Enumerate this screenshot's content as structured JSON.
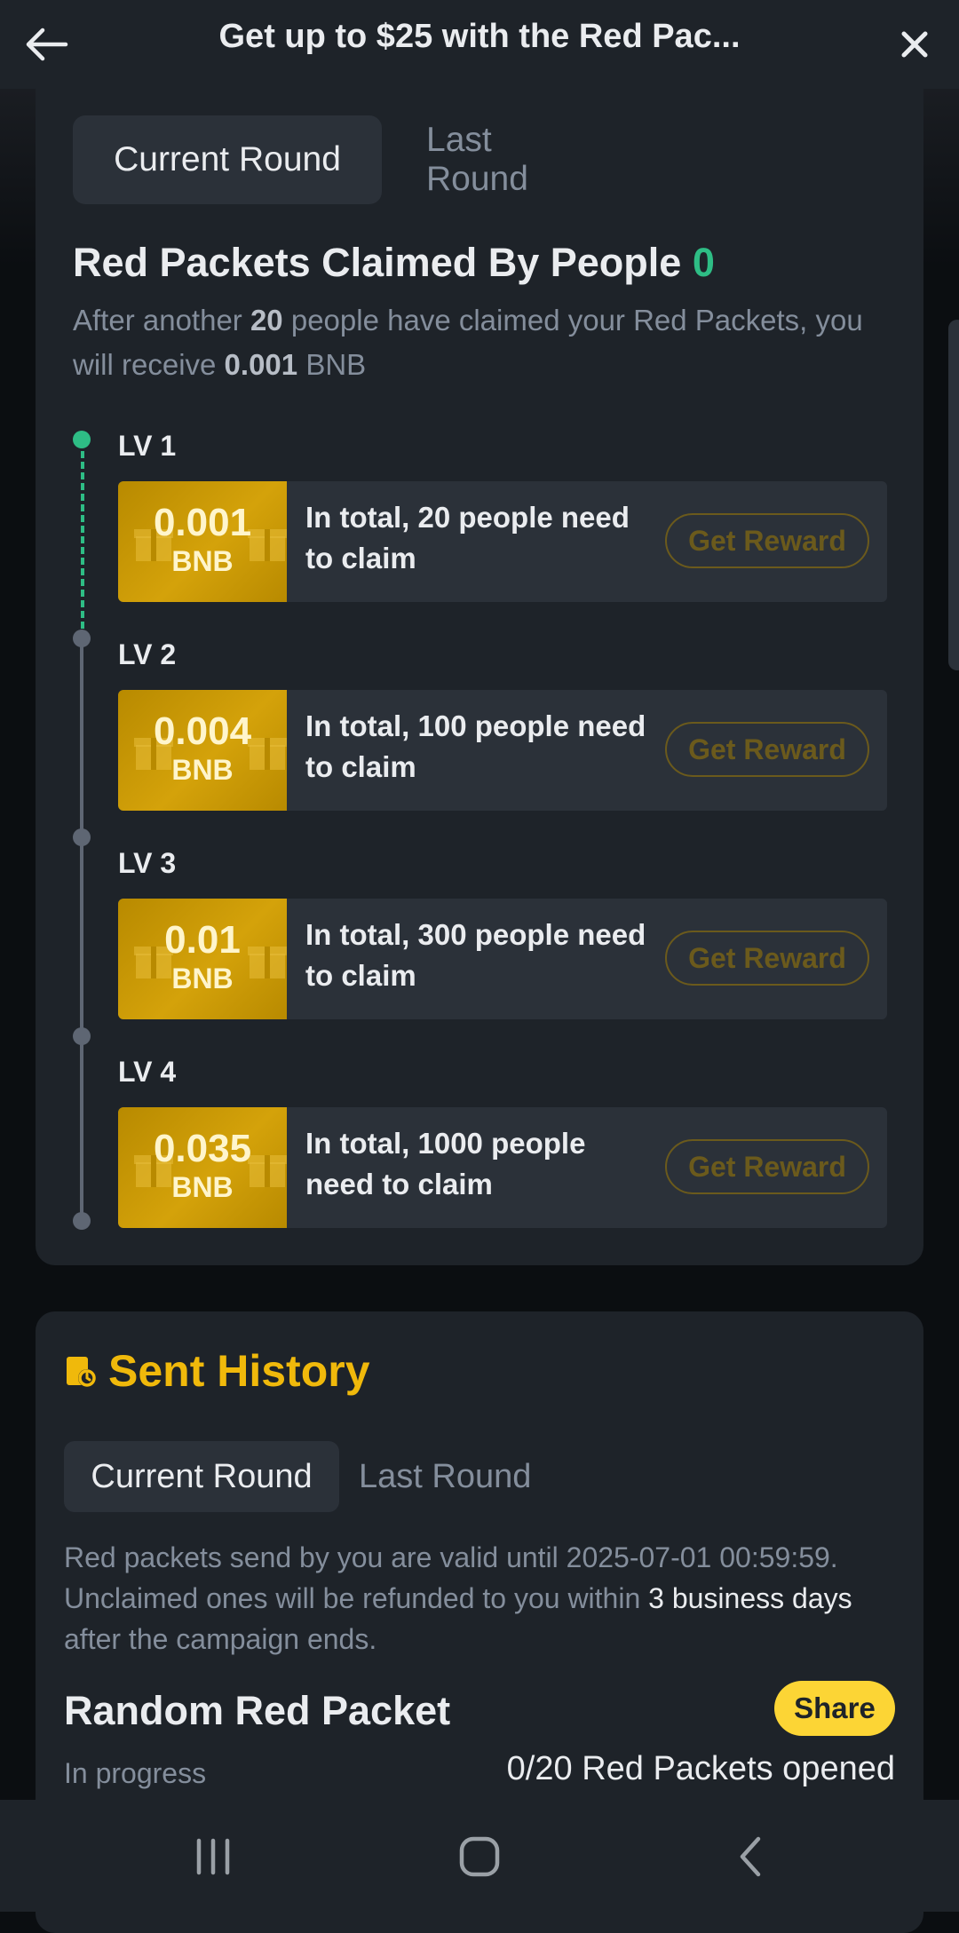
{
  "header": {
    "title": "Get up to $25 with the Red Pac..."
  },
  "invite_card": {
    "tabs": [
      {
        "label": "Current Round"
      },
      {
        "label": "Last Round"
      }
    ],
    "claimed_title": "Red Packets Claimed By People",
    "claimed_count": "0",
    "desc_prefix": "After another",
    "desc_people": "20",
    "desc_middle": "people have claimed your Red Packets, you will receive",
    "desc_amount": "0.001",
    "desc_unit": "BNB",
    "levels": [
      {
        "label": "LV 1",
        "amount": "0.001",
        "unit": "BNB",
        "text": "In total, 20 people need to claim",
        "button": "Get Reward"
      },
      {
        "label": "LV 2",
        "amount": "0.004",
        "unit": "BNB",
        "text": "In total, 100 people need to claim",
        "button": "Get Reward"
      },
      {
        "label": "LV 3",
        "amount": "0.01",
        "unit": "BNB",
        "text": "In total, 300 people need to claim",
        "button": "Get Reward"
      },
      {
        "label": "LV 4",
        "amount": "0.035",
        "unit": "BNB",
        "text": "In total, 1000 people need to claim",
        "button": "Get Reward"
      }
    ]
  },
  "sent_history": {
    "title": "Sent History",
    "tabs": [
      {
        "label": "Current Round"
      },
      {
        "label": "Last Round"
      }
    ],
    "desc_part1": "Red packets send by you are valid until 2025-07-01 00:59:59. Unclaimed ones will be refunded to you within",
    "desc_highlight": "3 business days",
    "desc_part2": "after the campaign ends.",
    "packet_title": "Random Red Packet",
    "share_label": "Share",
    "status": "In progress",
    "opened": "0/20 Red Packets opened"
  },
  "colors": {
    "accent": "#f0b90b",
    "success": "#2ebd85",
    "card": "#1e2329",
    "button_yellow": "#fcd535"
  },
  "icons": {
    "back": "arrow-left-icon",
    "close": "close-icon",
    "history": "history-icon",
    "gift": "gift-icon",
    "nav_recents": "recents-icon",
    "nav_home": "home-icon",
    "nav_back": "chevron-left-icon"
  }
}
